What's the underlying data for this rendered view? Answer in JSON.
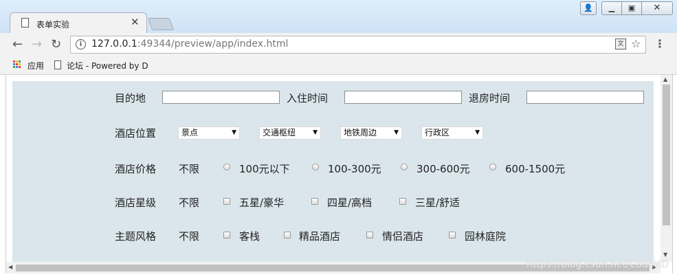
{
  "tab": {
    "title": "表单实验"
  },
  "address": {
    "host": "127.0.0.1",
    "rest": ":49344/preview/app/index.html"
  },
  "bookmarks": {
    "apps": "应用",
    "forum": "论坛 - Powered by D"
  },
  "form": {
    "destination_label": "目的地",
    "checkin_label": "入住时间",
    "checkout_label": "退房时间",
    "location_label": "酒店位置",
    "location_selects": [
      "景点",
      "交通枢纽",
      "地铁周边",
      "行政区"
    ],
    "price_label": "酒店价格",
    "price_unlimited": "不限",
    "price_options": [
      "100元以下",
      "100-300元",
      "300-600元",
      "600-1500元"
    ],
    "star_label": "酒店星级",
    "star_unlimited": "不限",
    "star_options": [
      "五星/豪华",
      "四星/高档",
      "三星/舒适"
    ],
    "theme_label": "主题风格",
    "theme_unlimited": "不限",
    "theme_options": [
      "客栈",
      "精品酒店",
      "情侣酒店",
      "园林庭院"
    ]
  },
  "watermark": "https://blog.csdn.net/CodeHD",
  "icons": [
    "doc-icon",
    "close-icon",
    "back-icon",
    "forward-icon",
    "reload-icon",
    "info-icon",
    "translate-icon",
    "star-icon",
    "menu-icon",
    "apps-icon"
  ]
}
